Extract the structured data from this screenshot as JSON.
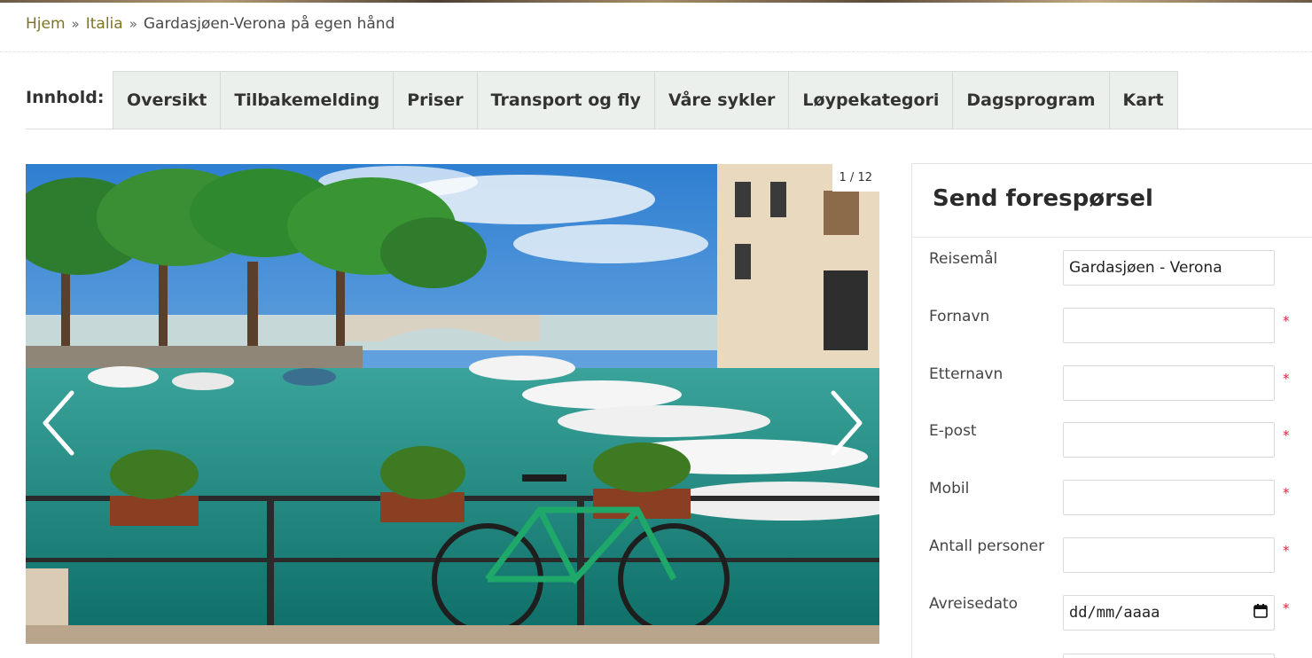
{
  "breadcrumb": {
    "home": "Hjem",
    "separator": "»",
    "country": "Italia",
    "current": "Gardasjøen-Verona på egen hånd"
  },
  "nav": {
    "label": "Innhold:",
    "tabs": [
      "Oversikt",
      "Tilbakemelding",
      "Priser",
      "Transport og fly",
      "Våre sykler",
      "Løypekategori",
      "Dagsprogram",
      "Kart"
    ]
  },
  "carousel": {
    "counter": "1 / 12",
    "prev_icon": "chevron-left-icon",
    "next_icon": "chevron-right-icon",
    "image": "lakeside harbour with boats, bridge and green bicycle"
  },
  "form": {
    "title": "Send forespørsel",
    "required_mark": "*",
    "fields": [
      {
        "label": "Reisemål",
        "value": "Gardasjøen - Verona",
        "required": false
      },
      {
        "label": "Fornavn",
        "value": "",
        "required": true
      },
      {
        "label": "Etternavn",
        "value": "",
        "required": true
      },
      {
        "label": "E-post",
        "value": "",
        "required": true
      },
      {
        "label": "Mobil",
        "value": "",
        "required": true
      },
      {
        "label": "Antall personer",
        "value": "",
        "required": true
      },
      {
        "label": "Avreisedato",
        "value": "dd/mm/aaaa",
        "required": true
      }
    ]
  },
  "colors": {
    "link": "#7d7526",
    "tab_bg": "#ecf0ec",
    "required": "#d6283e"
  }
}
